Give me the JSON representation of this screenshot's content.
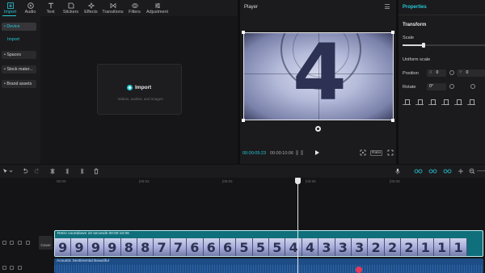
{
  "toolbar": {
    "items": [
      {
        "label": "Import",
        "icon": "import-icon"
      },
      {
        "label": "Audio",
        "icon": "audio-icon"
      },
      {
        "label": "Text",
        "icon": "text-icon"
      },
      {
        "label": "Stickers",
        "icon": "stickers-icon"
      },
      {
        "label": "Effects",
        "icon": "effects-icon"
      },
      {
        "label": "Transitions",
        "icon": "transitions-icon"
      },
      {
        "label": "Filters",
        "icon": "filters-icon"
      },
      {
        "label": "Adjustment",
        "icon": "adjustment-icon"
      }
    ]
  },
  "sidebar": {
    "items": [
      {
        "label": "• Device"
      },
      {
        "label": "• Spaces"
      },
      {
        "label": "• Stock mater..."
      },
      {
        "label": "• Brand assets"
      }
    ],
    "sub_item": "Import"
  },
  "media": {
    "import_label": "Import",
    "import_hint": "Videos, audios, and images"
  },
  "player": {
    "title": "Player",
    "frame_digit": "4",
    "time_current": "00:00:05:23",
    "time_total": "00:00:10:06",
    "ratio_label": "Ratio"
  },
  "properties": {
    "title": "Properties",
    "section": "Transform",
    "scale_label": "Scale",
    "scale_fraction": 0.25,
    "uniform_scale_label": "Uniform scale",
    "position_label": "Position",
    "position_x_prefix": "X",
    "position_x_value": "0",
    "position_y_prefix": "Y",
    "position_y_value": "0",
    "rotate_label": "Rotate",
    "rotate_value": "0°"
  },
  "timeline": {
    "ruler_labels": [
      "00:00",
      "|00:02",
      "|00:04",
      "|00:06",
      "|00:08"
    ],
    "cover_label": "Cover",
    "video_clip_label": "Retro countdown 10 seconds  00:00:10:06",
    "thumb_digits": [
      "9",
      "9",
      "9",
      "9",
      "8",
      "8",
      "7",
      "7",
      "6",
      "6",
      "6",
      "5",
      "5",
      "5",
      "4",
      "4",
      "3",
      "3",
      "3",
      "2",
      "2",
      "2",
      "1",
      "1",
      "1"
    ],
    "audio_clip_label": "Acoustic Sentimental Beautiful"
  },
  "colors": {
    "accent": "#27c7d6",
    "video_clip": "#0f6f7a",
    "audio_clip": "#1e4d86",
    "audio_marker": "#e8375a"
  }
}
